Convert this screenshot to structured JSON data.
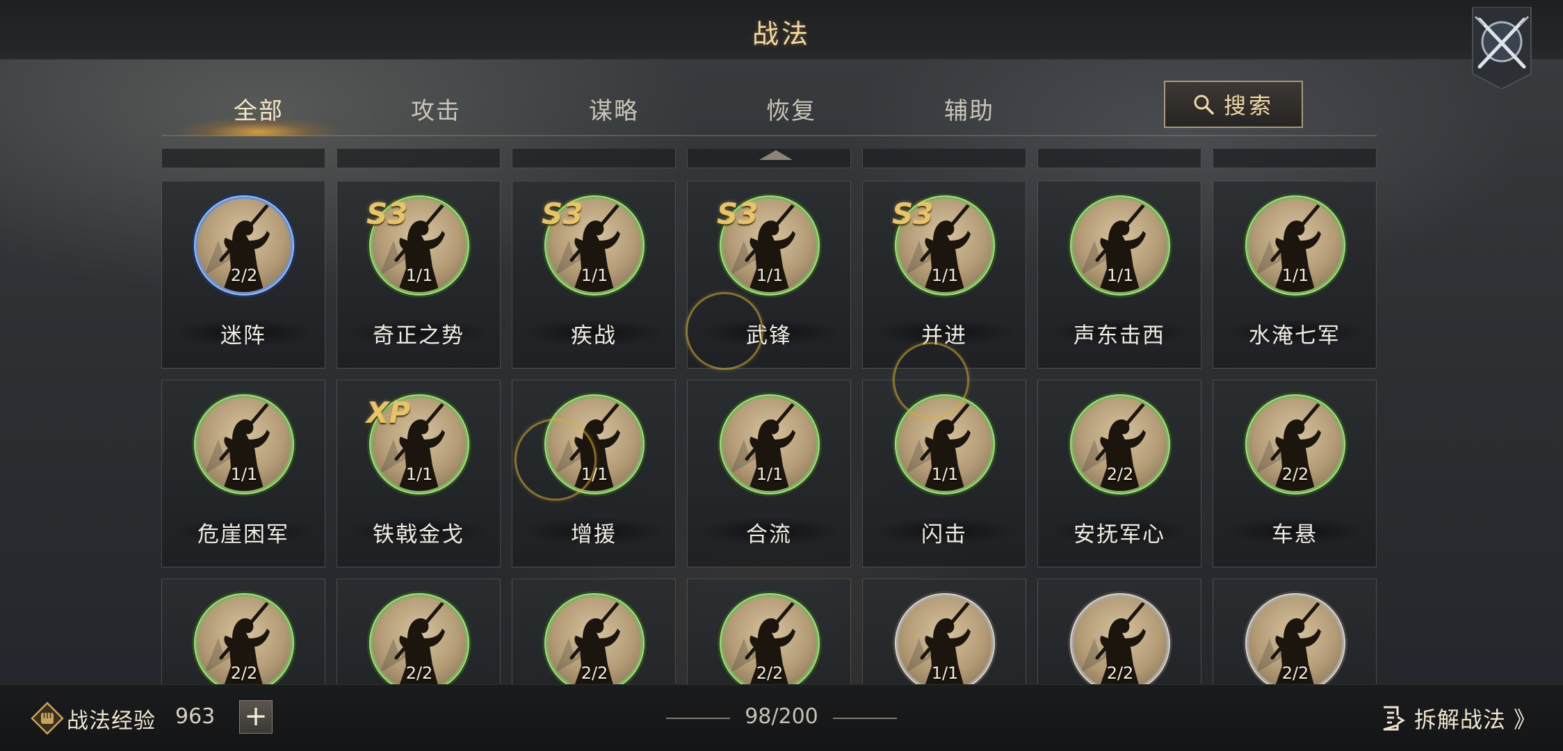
{
  "header": {
    "title": "战法"
  },
  "tabs": [
    {
      "label": "全部",
      "active": true
    },
    {
      "label": "攻击",
      "active": false
    },
    {
      "label": "谋略",
      "active": false
    },
    {
      "label": "恢复",
      "active": false
    },
    {
      "label": "辅助",
      "active": false
    }
  ],
  "search": {
    "label": "搜索"
  },
  "skills": [
    {
      "name": "迷阵",
      "level": "2/2",
      "frame": "blue",
      "badge": ""
    },
    {
      "name": "奇正之势",
      "level": "1/1",
      "frame": "green",
      "badge": "S3"
    },
    {
      "name": "疾战",
      "level": "1/1",
      "frame": "green",
      "badge": "S3"
    },
    {
      "name": "武锋",
      "level": "1/1",
      "frame": "green",
      "badge": "S3"
    },
    {
      "name": "并进",
      "level": "1/1",
      "frame": "green",
      "badge": "S3"
    },
    {
      "name": "声东击西",
      "level": "1/1",
      "frame": "green",
      "badge": ""
    },
    {
      "name": "水淹七军",
      "level": "1/1",
      "frame": "green",
      "badge": ""
    },
    {
      "name": "危崖困军",
      "level": "1/1",
      "frame": "green",
      "badge": ""
    },
    {
      "name": "铁戟金戈",
      "level": "1/1",
      "frame": "green",
      "badge": "XP"
    },
    {
      "name": "增援",
      "level": "1/1",
      "frame": "green",
      "badge": ""
    },
    {
      "name": "合流",
      "level": "1/1",
      "frame": "green",
      "badge": ""
    },
    {
      "name": "闪击",
      "level": "1/1",
      "frame": "green",
      "badge": ""
    },
    {
      "name": "安抚军心",
      "level": "2/2",
      "frame": "green",
      "badge": ""
    },
    {
      "name": "车悬",
      "level": "2/2",
      "frame": "green",
      "badge": ""
    },
    {
      "name": "",
      "level": "2/2",
      "frame": "green",
      "badge": ""
    },
    {
      "name": "",
      "level": "2/2",
      "frame": "green",
      "badge": ""
    },
    {
      "name": "",
      "level": "2/2",
      "frame": "green",
      "badge": ""
    },
    {
      "name": "",
      "level": "2/2",
      "frame": "green",
      "badge": ""
    },
    {
      "name": "",
      "level": "1/1",
      "frame": "gray",
      "badge": ""
    },
    {
      "name": "",
      "level": "2/2",
      "frame": "gray",
      "badge": ""
    },
    {
      "name": "",
      "level": "2/2",
      "frame": "gray",
      "badge": ""
    }
  ],
  "footer": {
    "exp_label": "战法经验",
    "exp_value": "963",
    "plus_label": "+",
    "count": "98/200",
    "disassemble_label": "拆解战法 》"
  },
  "colors": {
    "accent_gold": "#f0d9a8",
    "frame_green": "#8fbf6a",
    "frame_blue": "#7ea0d8",
    "frame_gray": "#b8b4ac",
    "badge_gold": "#e7c36b"
  },
  "icons": {
    "close": "crossed-swords-icon",
    "search": "magnifier-icon",
    "exp": "fist-emblem-icon",
    "disassemble": "document-list-icon",
    "scroll_up": "chevron-up-icon"
  }
}
